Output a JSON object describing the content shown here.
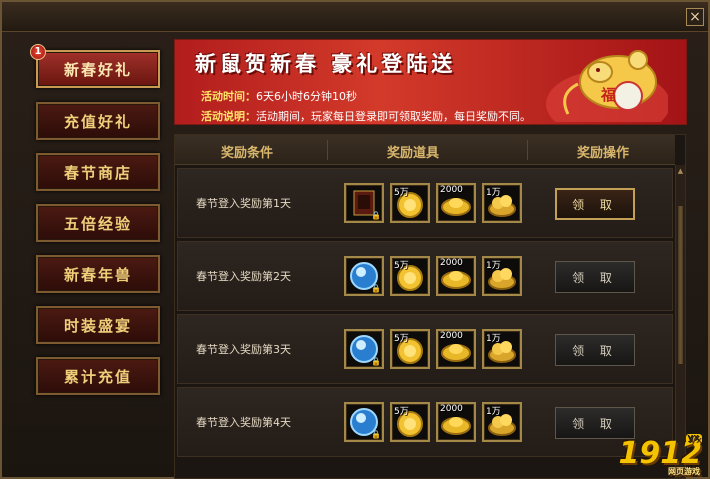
{
  "window": {
    "close_label": "×"
  },
  "nav": {
    "badge": "1",
    "items": [
      {
        "label": "新春好礼",
        "active": true
      },
      {
        "label": "充值好礼",
        "active": false
      },
      {
        "label": "春节商店",
        "active": false
      },
      {
        "label": "五倍经验",
        "active": false
      },
      {
        "label": "新春年兽",
        "active": false
      },
      {
        "label": "时装盛宴",
        "active": false
      },
      {
        "label": "累计充值",
        "active": false
      }
    ]
  },
  "banner": {
    "title": "新鼠贺新春 豪礼登陆送",
    "time_label": "活动时间：",
    "time_value": "6天6小时6分钟10秒",
    "desc_label": "活动说明：",
    "desc_value": "活动期间，玩家每日登录即可领取奖励，每日奖励不同。",
    "deco_glyph": "福"
  },
  "table": {
    "headers": [
      "奖励条件",
      "奖励道具",
      "奖励操作"
    ],
    "rows": [
      {
        "label": "春节登入奖励第1天",
        "items": [
          {
            "icon": "armor-icon",
            "num": "",
            "lock": true
          },
          {
            "icon": "gold-coin-icon",
            "num": "5万",
            "lock": false
          },
          {
            "icon": "gold-ingot-icon",
            "num": "2000",
            "lock": false
          },
          {
            "icon": "gold-pile-icon",
            "num": "1万",
            "lock": false
          }
        ],
        "button": "领 取",
        "active": true
      },
      {
        "label": "春节登入奖励第2天",
        "items": [
          {
            "icon": "blue-orb-icon",
            "num": "",
            "lock": true
          },
          {
            "icon": "gold-coin-icon",
            "num": "5万",
            "lock": false
          },
          {
            "icon": "gold-ingot-icon",
            "num": "2000",
            "lock": false
          },
          {
            "icon": "gold-pile-icon",
            "num": "1万",
            "lock": false
          }
        ],
        "button": "领 取",
        "active": false
      },
      {
        "label": "春节登入奖励第3天",
        "items": [
          {
            "icon": "blue-orb-icon",
            "num": "",
            "lock": true
          },
          {
            "icon": "gold-coin-icon",
            "num": "5万",
            "lock": false
          },
          {
            "icon": "gold-ingot-icon",
            "num": "2000",
            "lock": false
          },
          {
            "icon": "gold-pile-icon",
            "num": "1万",
            "lock": false
          }
        ],
        "button": "领 取",
        "active": false
      },
      {
        "label": "春节登入奖励第4天",
        "items": [
          {
            "icon": "blue-orb-icon",
            "num": "",
            "lock": true
          },
          {
            "icon": "gold-coin-icon",
            "num": "5万",
            "lock": false
          },
          {
            "icon": "gold-ingot-icon",
            "num": "2000",
            "lock": false
          },
          {
            "icon": "gold-pile-icon",
            "num": "1万",
            "lock": false
          }
        ],
        "button": "领 取",
        "active": false
      }
    ]
  },
  "watermark": {
    "text": "1912",
    "tag": "yx",
    "sub": "网页游戏"
  }
}
